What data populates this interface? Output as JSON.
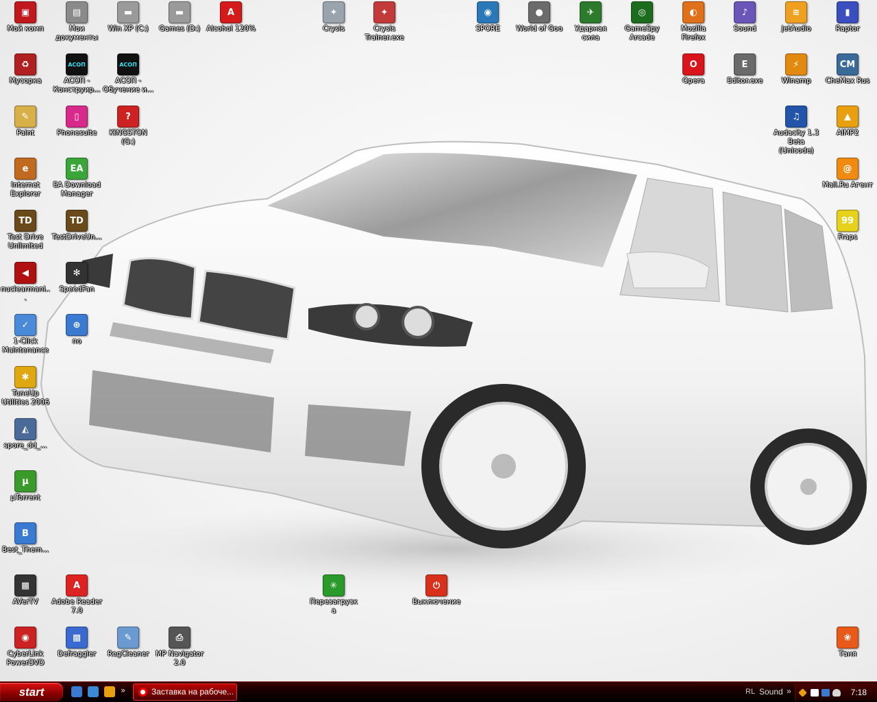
{
  "desktop": {
    "icons": [
      {
        "label": "Мой комп",
        "icon": "red-computer-icon",
        "color": "#c0181c",
        "glyph": "▣"
      },
      {
        "label": "Мои документы",
        "icon": "folder-icon",
        "color": "#8a8a8a",
        "glyph": "▤"
      },
      {
        "label": "Win XP (C:)",
        "icon": "drive-icon",
        "color": "#9a9a9a",
        "glyph": "▬"
      },
      {
        "label": "Games (D:)",
        "icon": "drive-icon",
        "color": "#9a9a9a",
        "glyph": "▬"
      },
      {
        "label": "Alcohol 120%",
        "icon": "alcohol-icon",
        "color": "#d41a1a",
        "glyph": "A"
      },
      {
        "label": "Crysis",
        "icon": "crysis-icon",
        "color": "#9aa4ad",
        "glyph": "✦"
      },
      {
        "label": "Crysis Trainer.exe",
        "icon": "crysis-trainer-icon",
        "color": "#c33a3a",
        "glyph": "✦"
      },
      {
        "label": "SPORE",
        "icon": "spore-icon",
        "color": "#2a78b8",
        "glyph": "◉"
      },
      {
        "label": "World of Goo",
        "icon": "world-of-goo-icon",
        "color": "#6b6b6b",
        "glyph": "●"
      },
      {
        "label": "Ударная сила",
        "icon": "helicopter-icon",
        "color": "#2c7a2c",
        "glyph": "✈"
      },
      {
        "label": "GameSpy Arcade",
        "icon": "gamespy-icon",
        "color": "#1d6b1d",
        "glyph": "◎"
      },
      {
        "label": "Mozilla Firefox",
        "icon": "firefox-icon",
        "color": "#e0701a",
        "glyph": "◐"
      },
      {
        "label": "Sound",
        "icon": "sound-icon",
        "color": "#6a55b8",
        "glyph": "♪"
      },
      {
        "label": "jetAudio",
        "icon": "jetaudio-icon",
        "color": "#f0a020",
        "glyph": "≋"
      },
      {
        "label": "Raptor",
        "icon": "raptor-icon",
        "color": "#3a4ec0",
        "glyph": "▮"
      },
      {
        "label": "Мусорка",
        "icon": "recycle-bin-icon",
        "color": "#b02020",
        "glyph": "♻"
      },
      {
        "label": "АСОП - Конструир...",
        "icon": "asop-icon",
        "color": "#111111",
        "glyph": "АСОП"
      },
      {
        "label": "АСОП - Обучение и...",
        "icon": "asop-icon",
        "color": "#111111",
        "glyph": "АСОП"
      },
      {
        "label": "Opera",
        "icon": "opera-icon",
        "color": "#d9141a",
        "glyph": "O"
      },
      {
        "label": "Editor.exe",
        "icon": "editor-icon",
        "color": "#6a6a6a",
        "glyph": "E"
      },
      {
        "label": "Winamp",
        "icon": "winamp-icon",
        "color": "#e28a10",
        "glyph": "⚡"
      },
      {
        "label": "CheMax Rus",
        "icon": "chemax-icon",
        "color": "#3a6a9a",
        "glyph": "CM"
      },
      {
        "label": "Paint",
        "icon": "paint-icon",
        "color": "#d8b04a",
        "glyph": "✎"
      },
      {
        "label": "Phonesuite",
        "icon": "phonesuite-icon",
        "color": "#d82a8a",
        "glyph": "▯"
      },
      {
        "label": "KINGSTON (G:)",
        "icon": "usb-drive-icon",
        "color": "#c22",
        "glyph": "?"
      },
      {
        "label": "Audacity 1.3 Beta (Unicode)",
        "icon": "audacity-icon",
        "color": "#2255aa",
        "glyph": "♫"
      },
      {
        "label": "AIMP2",
        "icon": "aimp-icon",
        "color": "#e8a010",
        "glyph": "▲"
      },
      {
        "label": "Internet Explorer",
        "icon": "internet-explorer-icon",
        "color": "#c06a20",
        "glyph": "e"
      },
      {
        "label": "EA Download Manager",
        "icon": "ea-icon",
        "color": "#3aa63a",
        "glyph": "EA"
      },
      {
        "label": "Mail.Ru Агент",
        "icon": "mailru-agent-icon",
        "color": "#f08a10",
        "glyph": "@"
      },
      {
        "label": "Test Drive Unlimited",
        "icon": "test-drive-icon",
        "color": "#6a4a1a",
        "glyph": "TD"
      },
      {
        "label": "TestDriveUn...",
        "icon": "test-drive-icon",
        "color": "#6a4a1a",
        "glyph": "TD"
      },
      {
        "label": "Fraps",
        "icon": "fraps-icon",
        "color": "#e6d21a",
        "glyph": "99"
      },
      {
        "label": "nuclearmani...",
        "icon": "nuclearmania-icon",
        "color": "#b01010",
        "glyph": "◀"
      },
      {
        "label": "SpeedFan",
        "icon": "speedfan-icon",
        "color": "#333333",
        "glyph": "✻"
      },
      {
        "label": "1-Click Maintenance",
        "icon": "maintenance-icon",
        "color": "#4a8ad8",
        "glyph": "✓"
      },
      {
        "label": "по",
        "icon": "network-icon",
        "color": "#3a7ad0",
        "glyph": "⊕"
      },
      {
        "label": "TuneUp Utilities 2006",
        "icon": "tuneup-icon",
        "color": "#e0a810",
        "glyph": "✱"
      },
      {
        "label": "spore_dd_...",
        "icon": "spore-installer-icon",
        "color": "#4a6a9a",
        "glyph": "◭"
      },
      {
        "label": "µTorrent",
        "icon": "utorrent-icon",
        "color": "#3a9a2a",
        "glyph": "µ"
      },
      {
        "label": "Best_Them...",
        "icon": "themes-icon",
        "color": "#3a7ad0",
        "glyph": "B"
      },
      {
        "label": "AVerTV",
        "icon": "avertv-icon",
        "color": "#333333",
        "glyph": "▦"
      },
      {
        "label": "Adobe Reader 7.0",
        "icon": "adobe-reader-icon",
        "color": "#d22",
        "glyph": "A"
      },
      {
        "label": "Перезагрузка",
        "icon": "restart-icon",
        "color": "#2a9a2a",
        "glyph": "✳"
      },
      {
        "label": "Выключение",
        "icon": "shutdown-icon",
        "color": "#d8301a",
        "glyph": "⏻"
      },
      {
        "label": "CyberLink PowerDVD",
        "icon": "powerdvd-icon",
        "color": "#c22",
        "glyph": "◉"
      },
      {
        "label": "Defraggler",
        "icon": "defraggler-icon",
        "color": "#3a6ad0",
        "glyph": "▩"
      },
      {
        "label": "RegCleaner",
        "icon": "regcleaner-icon",
        "color": "#6a9ad0",
        "glyph": "✎"
      },
      {
        "label": "MP Navigator 2.0",
        "icon": "mp-navigator-icon",
        "color": "#555555",
        "glyph": "⎙"
      },
      {
        "label": "Таня",
        "icon": "user-butterfly-icon",
        "color": "#e85a1a",
        "glyph": "❀"
      }
    ]
  },
  "taskbar": {
    "start_label": "start",
    "quick_launch": [
      {
        "icon": "show-desktop-icon",
        "color": "#3a7ad0"
      },
      {
        "icon": "network-icon",
        "color": "#3a8ad8"
      },
      {
        "icon": "aimp-icon",
        "color": "#e8a010"
      }
    ],
    "chevron": "»",
    "task_button_label": "Заставка на рабоче...",
    "tray": {
      "language": "RL",
      "sound_label": "Sound",
      "chevron": "»",
      "clock": "7:18"
    }
  }
}
